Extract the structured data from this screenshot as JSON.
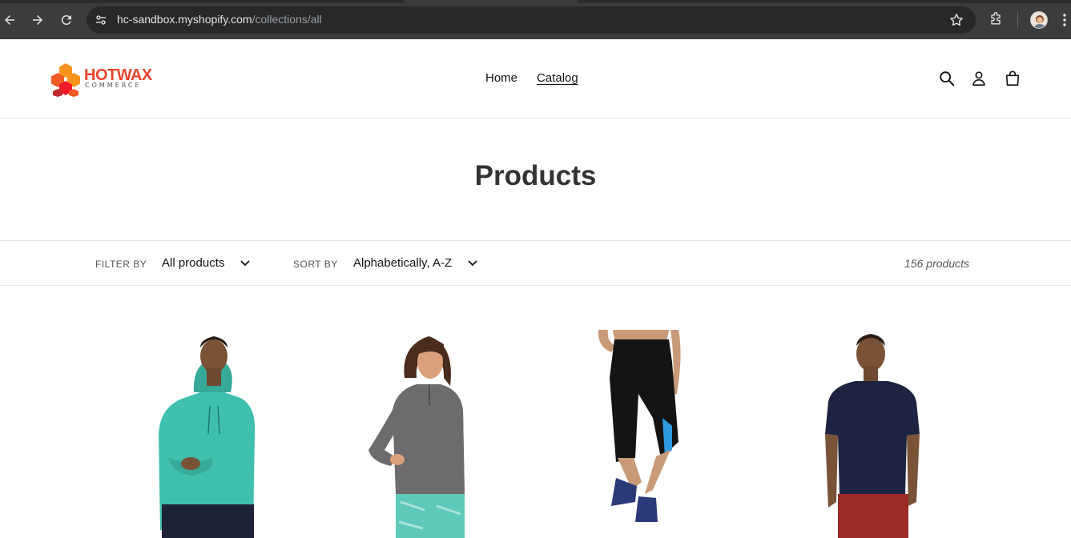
{
  "browser": {
    "url_host": "hc-sandbox.myshopify.com",
    "url_path": "/collections/all"
  },
  "store": {
    "logo_word": "HOTWAX",
    "logo_sub": "COMMERCE",
    "nav": [
      {
        "label": "Home"
      },
      {
        "label": "Catalog"
      }
    ]
  },
  "page": {
    "title": "Products"
  },
  "filters": {
    "filter_label": "FILTER BY",
    "filter_value": "All products",
    "sort_label": "SORT BY",
    "sort_value": "Alphabetically, A-Z",
    "count": "156 products"
  },
  "products": [
    {
      "image": "man-teal-hoodie",
      "color": "#3fbfae"
    },
    {
      "image": "woman-gray-pullover",
      "color": "#6d6b6e"
    },
    {
      "image": "black-capri-leggings",
      "color": "#141414"
    },
    {
      "image": "man-navy-tshirt",
      "color": "#1d2340"
    }
  ]
}
